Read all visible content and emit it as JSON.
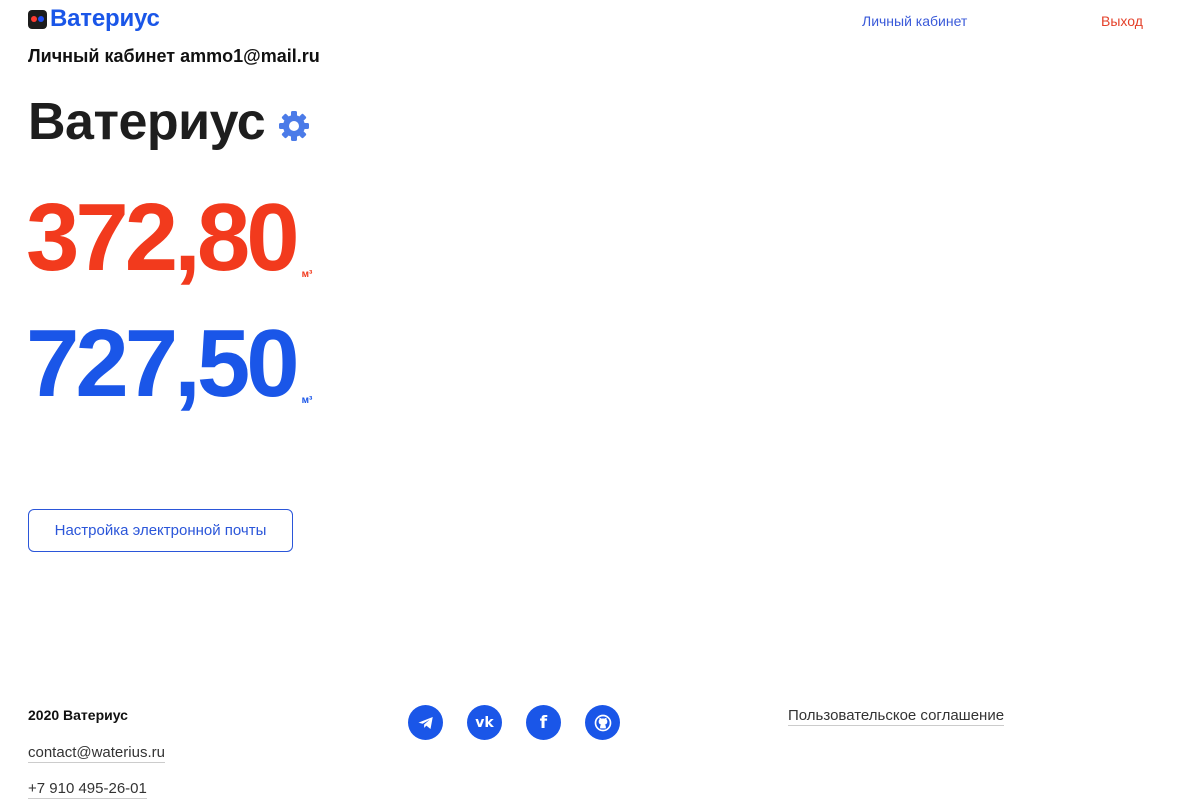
{
  "header": {
    "logo_text": "Ватериус",
    "nav": {
      "cabinet": "Личный кабинет",
      "exit": "Выход"
    }
  },
  "account": {
    "label": "Личный кабинет ammo1@mail.ru"
  },
  "device": {
    "title": "Ватериус",
    "settings_icon": "gear-icon"
  },
  "readings": {
    "hot": {
      "value": "372,80",
      "unit": "м³",
      "color": "#f23a1d"
    },
    "cold": {
      "value": "727,50",
      "unit": "м³",
      "color": "#1a56e8"
    }
  },
  "buttons": {
    "email_settings": "Настройка электронной почты"
  },
  "footer": {
    "copyright": "2020 Ватериус",
    "email": "contact@waterius.ru",
    "phone": "+7 910 495-26-01",
    "terms": "Пользовательское соглашение",
    "social": [
      {
        "icon": "telegram-icon"
      },
      {
        "icon": "vk-icon",
        "text": "vk"
      },
      {
        "icon": "facebook-icon",
        "text": "f"
      },
      {
        "icon": "github-icon"
      }
    ]
  },
  "colors": {
    "accent": "#1a56e8",
    "hot": "#f23a1d",
    "exit": "#e4412a"
  }
}
